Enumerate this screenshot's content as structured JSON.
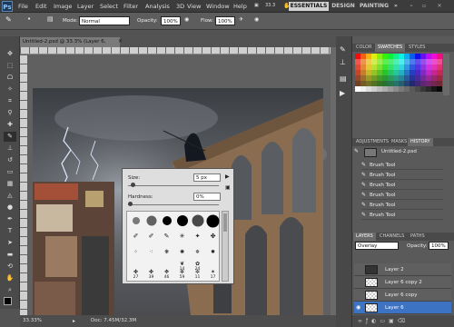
{
  "app": {
    "logo": "Ps",
    "zoom_level": "33.3",
    "document_tab": "Untitled-2.psd @ 33.3% (Layer 6, RGB/8) *"
  },
  "menu": [
    "File",
    "Edit",
    "Image",
    "Layer",
    "Select",
    "Filter",
    "Analysis",
    "3D",
    "View",
    "Window",
    "Help"
  ],
  "workspaces": {
    "essentials": "ESSENTIALS",
    "design": "DESIGN",
    "painting": "PAINTING",
    "more": "»"
  },
  "options": {
    "mode_label": "Mode:",
    "mode_value": "Normal",
    "opacity_label": "Opacity:",
    "opacity_value": "100%",
    "flow_label": "Flow:",
    "flow_value": "100%"
  },
  "status": {
    "zoom": "33.33%",
    "doc": "Doc: 7.45M/32.3M"
  },
  "brush_popup": {
    "size_label": "Size:",
    "size_value": "5 px",
    "hardness_label": "Hardness:",
    "hardness_value": "0%",
    "size_fraction": 0.05,
    "hardness_fraction": 0.0,
    "brush_numbers": [
      "27",
      "39",
      "46",
      "59",
      "11",
      "17"
    ],
    "brush_labels_row4": [
      "14",
      "24"
    ]
  },
  "panels": {
    "color_tabs": [
      "COLOR",
      "SWATCHES",
      "STYLES"
    ],
    "history_tabs": [
      "ADJUSTMENTS",
      "MASKS",
      "HISTORY"
    ],
    "history_snapshot": "Untitled-2.psd",
    "history_items": [
      "Brush Tool",
      "Brush Tool",
      "Brush Tool",
      "Brush Tool",
      "Brush Tool",
      "Brush Tool"
    ],
    "layers_tabs": [
      "LAYERS",
      "CHANNELS",
      "PATHS"
    ],
    "blend_mode": "Overlay",
    "opacity_label": "Opacity:",
    "opacity_value": "100%",
    "layers": [
      "Layer 2",
      "Layer 6 copy 2",
      "Layer 6 copy",
      "Layer 6"
    ]
  },
  "colors": {
    "accent": "#3d73c3",
    "active_workspace": "#d0d0d0"
  }
}
